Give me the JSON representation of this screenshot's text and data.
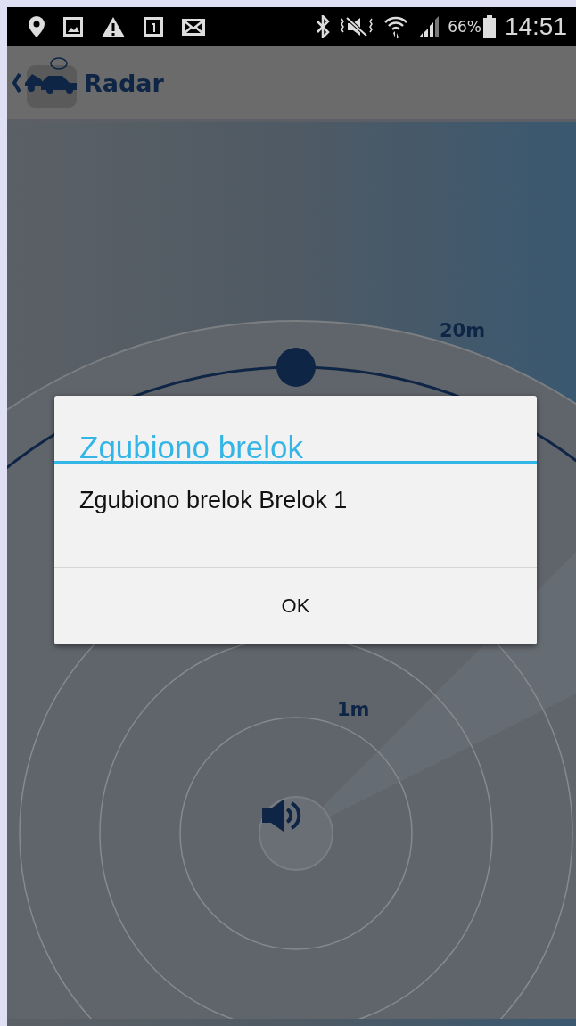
{
  "status_bar": {
    "battery_percent": "66%",
    "time": "14:51"
  },
  "app_bar": {
    "title": "Radar"
  },
  "radar": {
    "labels": [
      {
        "text": "20m"
      },
      {
        "text": "1m"
      }
    ]
  },
  "dialog": {
    "title": "Zgubiono brelok",
    "message": "Zgubiono brelok Brelok 1",
    "buttons": [
      "OK"
    ]
  }
}
